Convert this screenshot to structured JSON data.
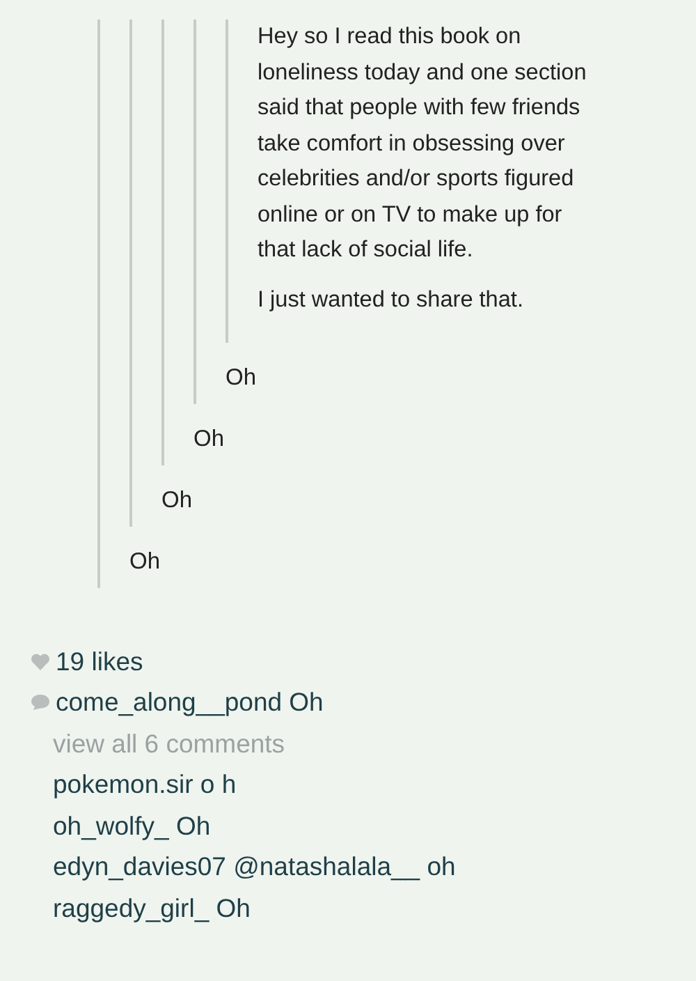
{
  "thread": {
    "reply": "Oh",
    "quote": {
      "reply": "Oh",
      "quote": {
        "reply": "Oh",
        "quote": {
          "reply": "Oh",
          "quote": {
            "paragraphs": [
              "Hey so I read this book on loneliness today and one section said that people with few friends take comfort in obsessing over celebrities and/or sports figured online or on TV to make up for that lack of social life.",
              "I just wanted to share that."
            ]
          }
        }
      }
    }
  },
  "likes": "19 likes",
  "caption": {
    "user": "come_along__pond",
    "text": "Oh"
  },
  "view_all": "view all 6 comments",
  "comments": [
    {
      "user": "pokemon.sir",
      "text": "o h"
    },
    {
      "user": "oh_wolfy_",
      "text": "Oh"
    },
    {
      "user": "edyn_davies07",
      "text": "@natashalala__ oh"
    },
    {
      "user": "raggedy_girl_",
      "text": "Oh"
    }
  ]
}
